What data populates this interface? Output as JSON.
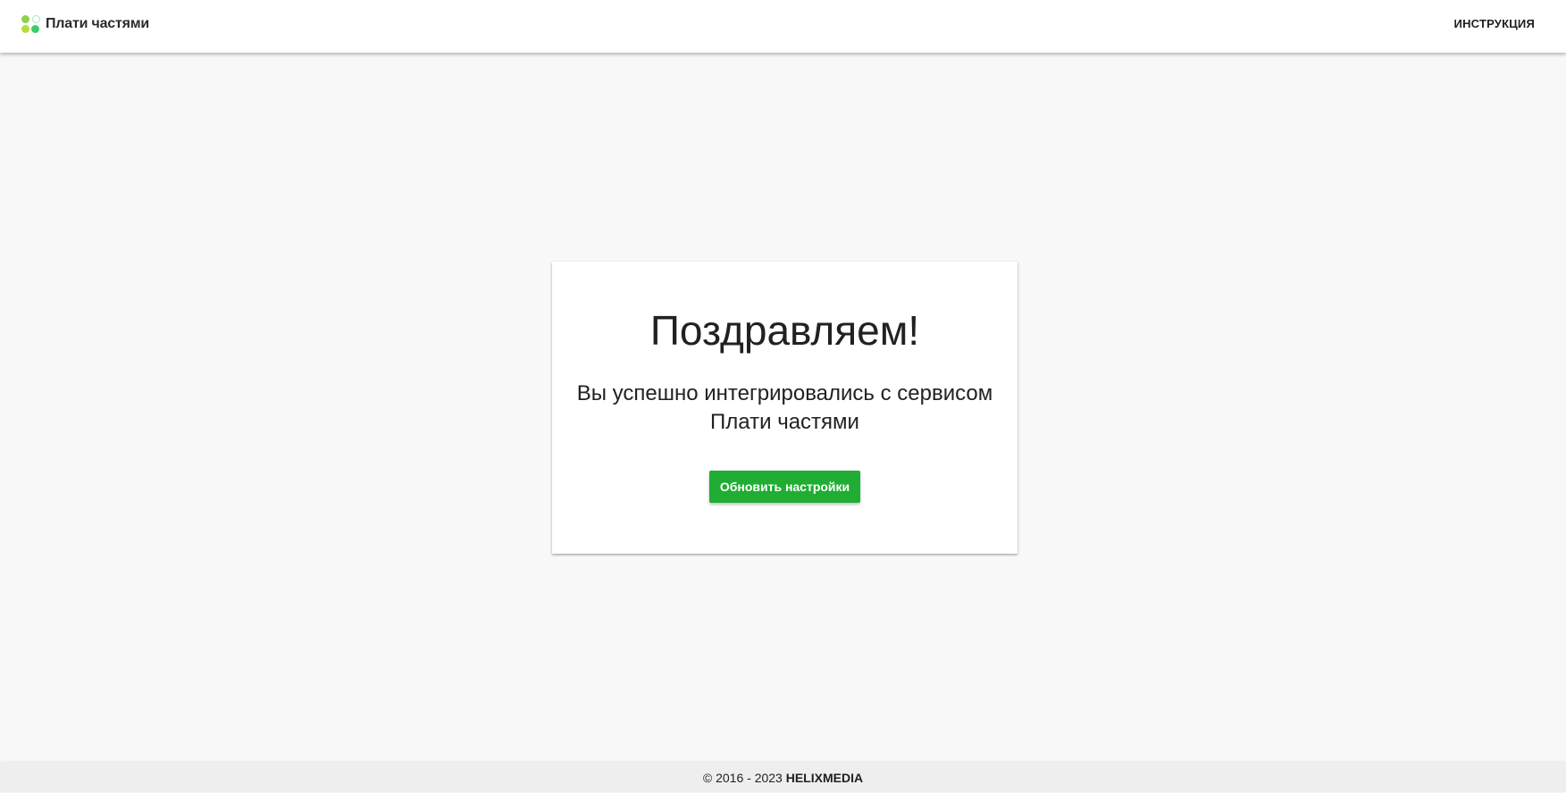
{
  "header": {
    "logo_text": "Плати частями",
    "nav_link": "ИНСТРУКЦИЯ",
    "logo_icon": "four-dots-logo-icon"
  },
  "card": {
    "title": "Поздравляем!",
    "message": "Вы успешно интегрировались с сервисом Плати частями",
    "button_label": "Обновить настройки"
  },
  "footer": {
    "copyright": "© 2016 - 2023",
    "company": "HELIXMEDIA"
  },
  "colors": {
    "accent": "#1fad33",
    "background": "#f8f8f8",
    "header_bg": "#ffffff",
    "footer_bg": "#eeeeee"
  }
}
